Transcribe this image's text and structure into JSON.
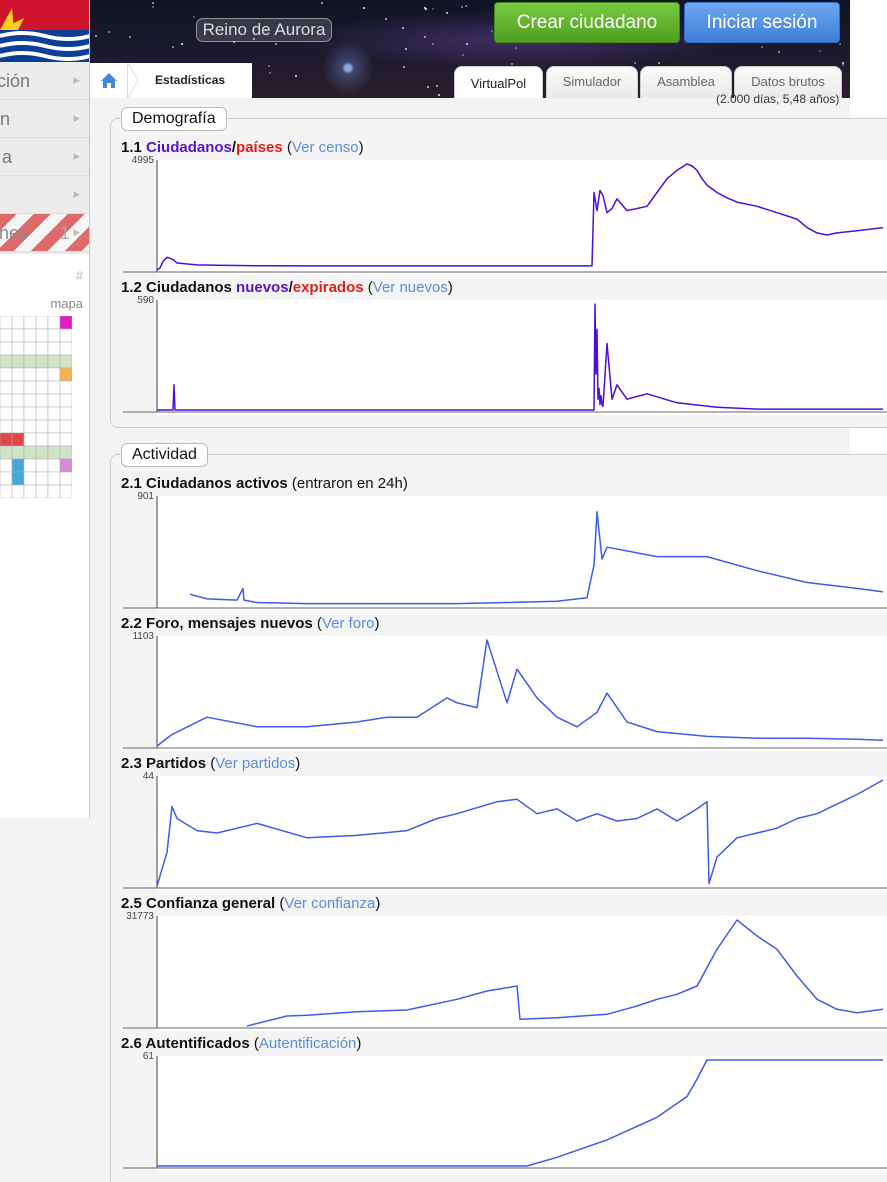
{
  "header": {
    "site_name": "Reino de Aurora",
    "create_button": "Crear ciudadano",
    "login_button": "Iniciar sesión",
    "breadcrumb": "Estadísticas",
    "tabs": [
      "VirtualPol",
      "Simulador",
      "Asamblea",
      "Datos brutos"
    ],
    "range_note": "(2.000 días, 5,48 años)"
  },
  "sidebar": {
    "items": [
      {
        "label": "ción"
      },
      {
        "label": "n"
      },
      {
        "label": "a"
      },
      {
        "label": ""
      },
      {
        "label": "nes",
        "count": "1"
      }
    ],
    "hash": "#",
    "map_label": "mapa"
  },
  "sections": {
    "demografia": "Demografía",
    "actividad": "Actividad"
  },
  "charts": {
    "c11": {
      "num": "1.1",
      "a": "Ciudadanos",
      "sep": "/",
      "b": "países",
      "open": " (",
      "link": "Ver censo",
      "close": ")",
      "ymax": "4995"
    },
    "c12": {
      "num": "1.2",
      "a": "Ciudadanos ",
      "a2": "nuevos",
      "sep": "/",
      "b": "expirados",
      "open": " (",
      "link": "Ver nuevos",
      "close": ")",
      "ymax": "590"
    },
    "c21": {
      "num": "2.1",
      "a": "Ciudadanos activos",
      "extra": " (entraron en 24h)",
      "ymax": "901"
    },
    "c22": {
      "num": "2.2",
      "a": "Foro, mensajes nuevos",
      "open": " (",
      "link": "Ver foro",
      "close": ")",
      "ymax": "1103"
    },
    "c23": {
      "num": "2.3",
      "a": "Partidos",
      "open": " (",
      "link": "Ver partidos",
      "close": ")",
      "ymax": "44"
    },
    "c25": {
      "num": "2.5",
      "a": "Confianza general",
      "open": " (",
      "link": "Ver confianza",
      "close": ")",
      "ymax": "31773"
    },
    "c26": {
      "num": "2.6",
      "a": "Autentificados",
      "open": " (",
      "link": "Autentificación",
      "close": ")",
      "ymax": "61"
    }
  },
  "colors": {
    "purple": "#4b0fd6",
    "red": "#e0201c",
    "blue": "#3d5ce8",
    "link": "#5b8ed6",
    "green_button": "#5aae28",
    "blue_button": "#4a8de4"
  },
  "chart_data": [
    {
      "type": "line",
      "title": "1.1 Ciudadanos/países",
      "ylim": [
        0,
        4995
      ],
      "series": [
        {
          "name": "Ciudadanos",
          "x": [
            0,
            3,
            6,
            10,
            16,
            20,
            40,
            60,
            80,
            90,
            100,
            110,
            150,
            200,
            250,
            300,
            350,
            400,
            420,
            430,
            435,
            437,
            440,
            443,
            446,
            450,
            455,
            460,
            470,
            480,
            490,
            500,
            510,
            520,
            530,
            535,
            540,
            545,
            550,
            560,
            570,
            580,
            600,
            620,
            640,
            650,
            660,
            670,
            680,
            700,
            726
          ],
          "y": [
            0,
            100,
            400,
            600,
            500,
            330,
            240,
            220,
            210,
            205,
            200,
            200,
            195,
            195,
            195,
            195,
            195,
            195,
            195,
            195,
            200,
            3650,
            2800,
            3750,
            3500,
            2700,
            2900,
            3350,
            2800,
            2900,
            3000,
            3650,
            4300,
            4700,
            5000,
            4900,
            4700,
            4300,
            4000,
            3650,
            3400,
            3200,
            3000,
            2700,
            2400,
            2000,
            1750,
            1650,
            1750,
            1850,
            2000
          ]
        }
      ]
    },
    {
      "type": "line",
      "title": "1.2 Ciudadanos nuevos/expirados",
      "ylim": [
        0,
        590
      ],
      "series": [
        {
          "name": "nuevos",
          "x": [
            0,
            16,
            17,
            18,
            60,
            100,
            200,
            300,
            437,
            438,
            439,
            440,
            441,
            442,
            443,
            444,
            445,
            446,
            450,
            455,
            460,
            470,
            490,
            520,
            560,
            600,
            726
          ],
          "y": [
            0,
            0,
            140,
            0,
            0,
            0,
            0,
            0,
            0,
            590,
            200,
            450,
            60,
            120,
            30,
            80,
            30,
            20,
            370,
            60,
            140,
            60,
            90,
            40,
            15,
            5,
            5
          ]
        }
      ]
    },
    {
      "type": "line",
      "title": "2.1 Ciudadanos activos (entraron en 24h)",
      "ylim": [
        0,
        901
      ],
      "series": [
        {
          "name": "Ciudadanos activos",
          "x": [
            33,
            50,
            80,
            86,
            87,
            100,
            150,
            200,
            250,
            300,
            350,
            400,
            430,
            437,
            440,
            445,
            450,
            500,
            550,
            600,
            650,
            700,
            726
          ],
          "y": [
            100,
            60,
            50,
            150,
            50,
            30,
            20,
            20,
            20,
            20,
            30,
            40,
            70,
            350,
            800,
            400,
            500,
            420,
            420,
            300,
            200,
            150,
            120
          ]
        }
      ]
    },
    {
      "type": "line",
      "title": "2.2 Foro, mensajes nuevos",
      "ylim": [
        0,
        1103
      ],
      "series": [
        {
          "name": "Foro",
          "x": [
            0,
            15,
            50,
            100,
            150,
            200,
            230,
            260,
            290,
            300,
            320,
            330,
            350,
            360,
            380,
            400,
            420,
            440,
            450,
            470,
            500,
            550,
            600,
            650,
            700,
            726
          ],
          "y": [
            0,
            120,
            300,
            200,
            200,
            250,
            300,
            300,
            500,
            450,
            400,
            1103,
            450,
            800,
            500,
            300,
            200,
            350,
            550,
            250,
            150,
            100,
            80,
            80,
            70,
            60
          ]
        }
      ]
    },
    {
      "type": "line",
      "title": "2.3 Partidos",
      "ylim": [
        0,
        44
      ],
      "series": [
        {
          "name": "Partidos",
          "x": [
            0,
            10,
            15,
            20,
            40,
            60,
            100,
            150,
            200,
            250,
            280,
            300,
            340,
            360,
            380,
            400,
            420,
            440,
            460,
            480,
            500,
            520,
            540,
            550,
            552,
            560,
            580,
            600,
            620,
            640,
            660,
            680,
            700,
            726
          ],
          "y": [
            0,
            14,
            33,
            28,
            23,
            22,
            26,
            20,
            21,
            23,
            28,
            30,
            35,
            36,
            30,
            32,
            27,
            30,
            27,
            28,
            32,
            27,
            32,
            35,
            1,
            12,
            20,
            22,
            24,
            28,
            30,
            34,
            38,
            44
          ]
        }
      ]
    },
    {
      "type": "line",
      "title": "2.5 Confianza general",
      "ylim": [
        0,
        31773
      ],
      "series": [
        {
          "name": "Confianza",
          "x": [
            90,
            130,
            150,
            200,
            250,
            300,
            330,
            360,
            363,
            400,
            450,
            480,
            500,
            520,
            540,
            560,
            580,
            600,
            620,
            640,
            660,
            680,
            700,
            726
          ],
          "y": [
            0,
            3000,
            3200,
            4300,
            4800,
            8000,
            10500,
            12000,
            2000,
            2500,
            3500,
            6000,
            8000,
            9500,
            12000,
            23000,
            31773,
            27000,
            23000,
            15000,
            8000,
            5000,
            4000,
            5000
          ]
        }
      ]
    },
    {
      "type": "line",
      "title": "2.6 Autentificados",
      "ylim": [
        0,
        61
      ],
      "series": [
        {
          "name": "Autentificados",
          "x": [
            0,
            370,
            400,
            450,
            500,
            530,
            540,
            550,
            600,
            650,
            700,
            726
          ],
          "y": [
            0,
            0,
            5,
            15,
            28,
            40,
            50,
            61,
            61,
            61,
            61,
            61
          ]
        }
      ]
    }
  ]
}
